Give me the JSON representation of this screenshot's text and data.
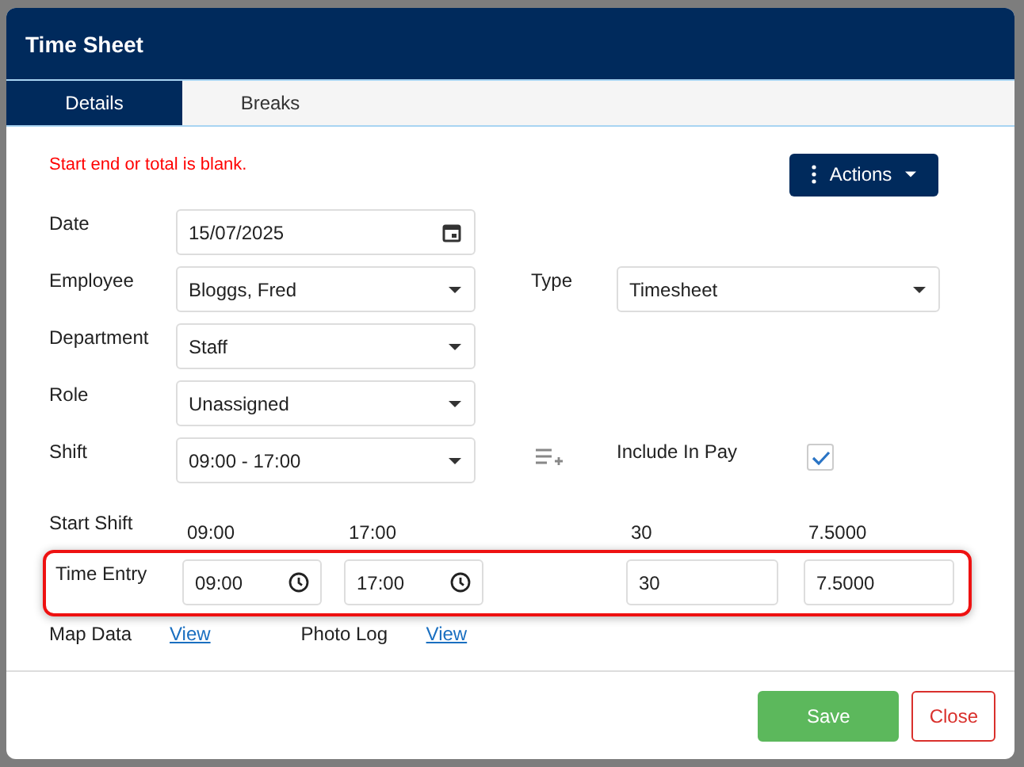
{
  "window": {
    "title": "Time Sheet"
  },
  "tabs": [
    {
      "label": "Details",
      "selected": true
    },
    {
      "label": "Breaks",
      "selected": false
    }
  ],
  "error_message": "Start end or total is blank.",
  "actions_button": {
    "label": "Actions"
  },
  "form_rows": [
    {
      "label": "Date",
      "field": {
        "kind": "date",
        "value": "15/07/2025"
      }
    },
    {
      "label": "Employee",
      "field": {
        "kind": "select",
        "value": "Bloggs, Fred"
      },
      "right": {
        "label": "Type",
        "field": {
          "kind": "select",
          "value": "Timesheet"
        }
      }
    },
    {
      "label": "Department",
      "field": {
        "kind": "select",
        "value": "Staff"
      }
    },
    {
      "label": "Role",
      "field": {
        "kind": "select",
        "value": "Unassigned"
      }
    },
    {
      "label": "Shift",
      "field": {
        "kind": "select",
        "value": "09:00 - 17:00"
      },
      "include_in_pay": {
        "label": "Include In Pay",
        "checked": true
      }
    }
  ],
  "start_shift": {
    "label": "Start Shift",
    "start": "09:00",
    "end": "17:00",
    "break": "30",
    "total": "7.5000"
  },
  "time_entry": {
    "label": "Time Entry",
    "highlighted": true,
    "start": "09:00",
    "end": "17:00",
    "break": "30",
    "total": "7.5000"
  },
  "links": [
    {
      "label": "Map Data",
      "link": "View"
    },
    {
      "label": "Photo Log",
      "link": "View"
    }
  ],
  "buttons": [
    {
      "kind": "primary",
      "label": "Save"
    },
    {
      "kind": "danger",
      "label": "Close"
    }
  ]
}
